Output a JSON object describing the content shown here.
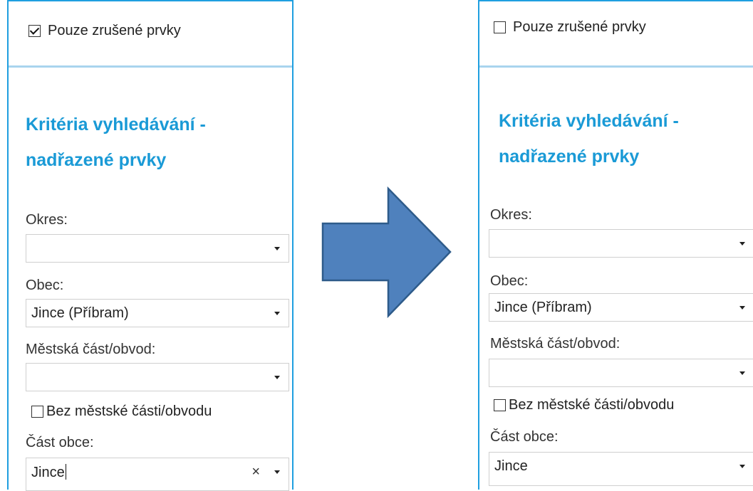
{
  "left_panel": {
    "only_cancelled": {
      "label": "Pouze zrušené prvky",
      "checked": true
    },
    "heading_line1": "Kritéria vyhledávání -",
    "heading_line2": "nadřazené prvky",
    "okres": {
      "label": "Okres:",
      "value": ""
    },
    "obec": {
      "label": "Obec:",
      "value": "Jince (Příbram)"
    },
    "mestska_cast": {
      "label": "Městská část/obvod:",
      "value": ""
    },
    "bez_mestske_casti": {
      "label": "Bez městské části/obvodu",
      "checked": false
    },
    "cast_obce": {
      "label": "Část obce:",
      "value": "Jince",
      "clear_symbol": "×"
    }
  },
  "right_panel": {
    "only_cancelled": {
      "label": "Pouze zrušené prvky",
      "checked": false
    },
    "heading_line1": "Kritéria vyhledávání -",
    "heading_line2": "nadřazené prvky",
    "okres": {
      "label": "Okres:",
      "value": ""
    },
    "obec": {
      "label": "Obec:",
      "value": "Jince (Příbram)"
    },
    "mestska_cast": {
      "label": "Městská část/obvod:",
      "value": ""
    },
    "bez_mestske_casti": {
      "label": "Bez městské části/obvodu",
      "checked": false
    },
    "cast_obce": {
      "label": "Část obce:",
      "value": "Jince"
    }
  },
  "colors": {
    "accent": "#1a9ad6",
    "border": "#1f9fe0",
    "arrow_fill": "#4f81bd",
    "arrow_stroke": "#2e5b8a"
  },
  "icons": {
    "dropdown": "chevron-down-icon",
    "clear": "clear-icon",
    "transition": "right-arrow-icon"
  }
}
